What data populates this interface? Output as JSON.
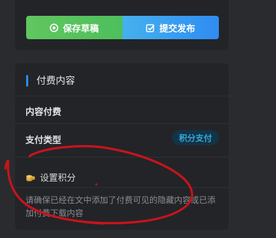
{
  "toolbar": {
    "save_label": "保存草稿",
    "publish_label": "提交发布",
    "save_color": "#5bc45e",
    "publish_color": "#2f8cf2"
  },
  "pay_section": {
    "title": "付费内容",
    "content_pay_label": "内容付费",
    "pay_type_label": "支付类型",
    "pay_type_value": "积分支付",
    "points_label": "设置积分",
    "description": "请确保已经在文中添加了付费可见的隐藏内容或已添加付费下载内容",
    "accent_color": "#2f8cf2"
  },
  "icons": {
    "save": "record-icon",
    "publish": "edit-check-icon",
    "points": "coins-icon"
  }
}
